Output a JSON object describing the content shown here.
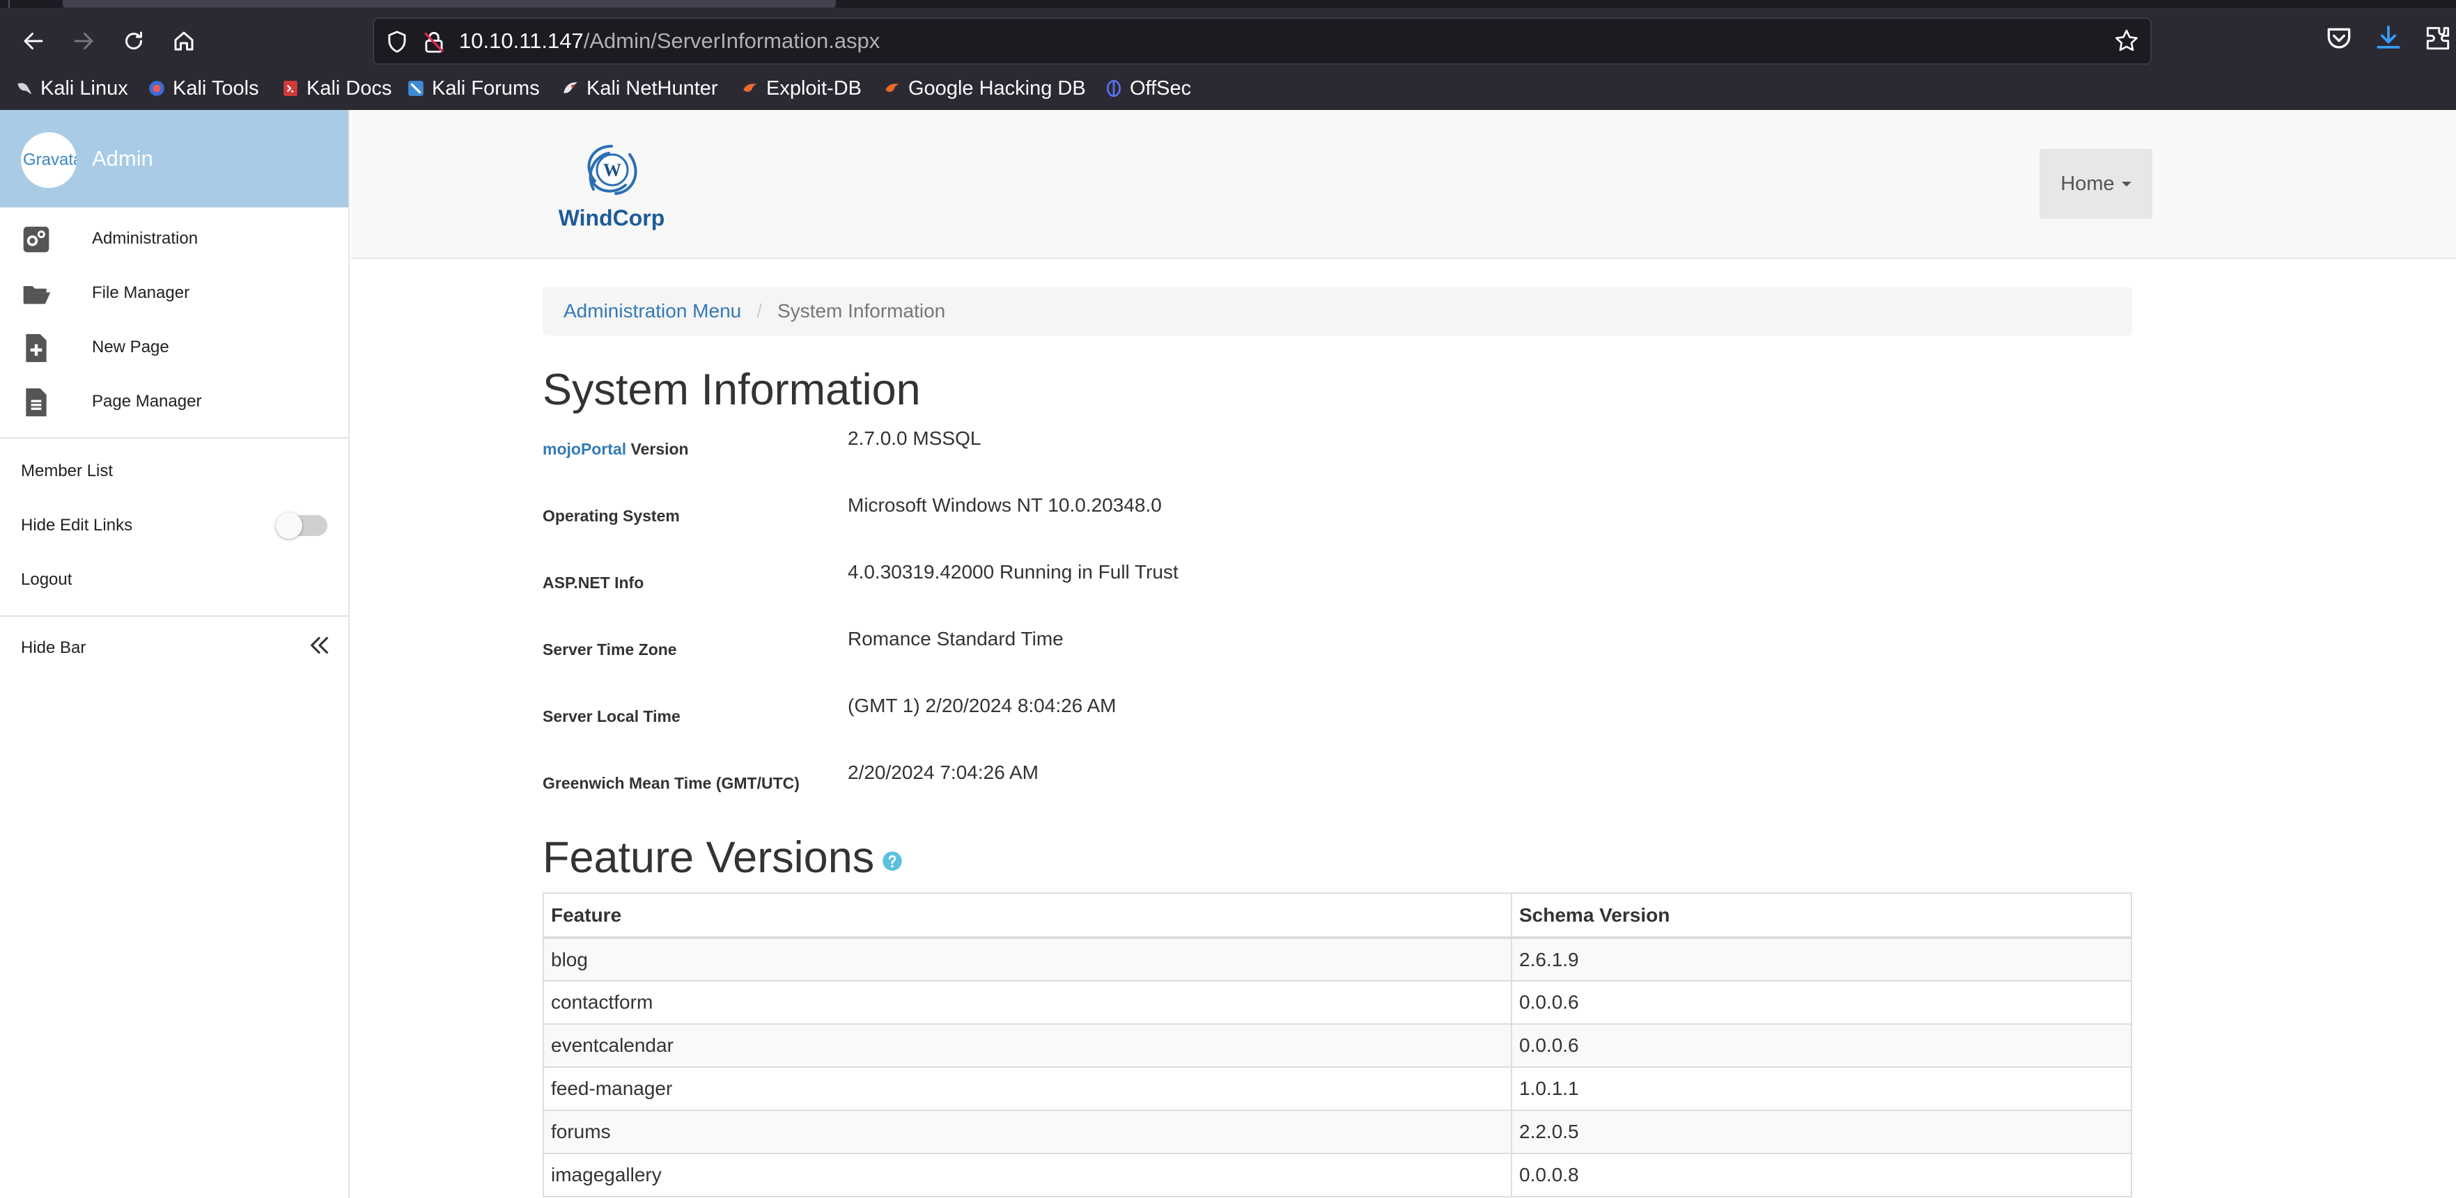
{
  "browser": {
    "url_host": "10.10.11.147",
    "url_path": "/Admin/ServerInformation.aspx",
    "bookmarks": [
      {
        "label": "Kali Linux",
        "icon": "kali-dragon-icon"
      },
      {
        "label": "Kali Tools",
        "icon": "kali-tools-icon"
      },
      {
        "label": "Kali Docs",
        "icon": "kali-docs-icon"
      },
      {
        "label": "Kali Forums",
        "icon": "kali-forums-icon"
      },
      {
        "label": "Kali NetHunter",
        "icon": "kali-nethunter-icon"
      },
      {
        "label": "Exploit-DB",
        "icon": "exploit-db-icon"
      },
      {
        "label": "Google Hacking DB",
        "icon": "ghdb-icon"
      },
      {
        "label": "OffSec",
        "icon": "offsec-icon"
      }
    ]
  },
  "sidebar": {
    "avatar_text": "Gravatar",
    "user": "Admin",
    "items": [
      {
        "label": "Administration",
        "icon": "administration-gears-icon"
      },
      {
        "label": "File Manager",
        "icon": "folder-open-icon"
      },
      {
        "label": "New Page",
        "icon": "new-page-icon"
      },
      {
        "label": "Page Manager",
        "icon": "page-manager-icon"
      }
    ],
    "member_list": "Member List",
    "hide_edit_links": "Hide Edit Links",
    "hide_edit_links_on": false,
    "logout": "Logout",
    "hide_bar": "Hide Bar"
  },
  "header": {
    "logo_text": "WindCorp",
    "logo_mark": "W",
    "home": "Home"
  },
  "breadcrumb": {
    "parent": "Administration Menu",
    "current": "System Information"
  },
  "system_info": {
    "title": "System Information",
    "rows": [
      {
        "label_link": "mojoPortal",
        "label": " Version",
        "value": "2.7.0.0 MSSQL"
      },
      {
        "label": "Operating System",
        "value": "Microsoft Windows NT 10.0.20348.0"
      },
      {
        "label": "ASP.NET Info",
        "value": "4.0.30319.42000 Running in Full Trust"
      },
      {
        "label": "Server Time Zone",
        "value": "Romance Standard Time"
      },
      {
        "label": "Server Local Time",
        "value": "(GMT 1) 2/20/2024 8:04:26 AM"
      },
      {
        "label": "Greenwich Mean Time (GMT/UTC)",
        "value": "2/20/2024 7:04:26 AM"
      }
    ]
  },
  "feature_versions": {
    "title": "Feature Versions",
    "columns": [
      "Feature",
      "Schema Version"
    ],
    "rows": [
      [
        "blog",
        "2.6.1.9"
      ],
      [
        "contactform",
        "0.0.0.6"
      ],
      [
        "eventcalendar",
        "0.0.0.6"
      ],
      [
        "feed-manager",
        "1.0.1.1"
      ],
      [
        "forums",
        "2.2.0.5"
      ],
      [
        "imagegallery",
        "0.0.0.8"
      ]
    ]
  }
}
